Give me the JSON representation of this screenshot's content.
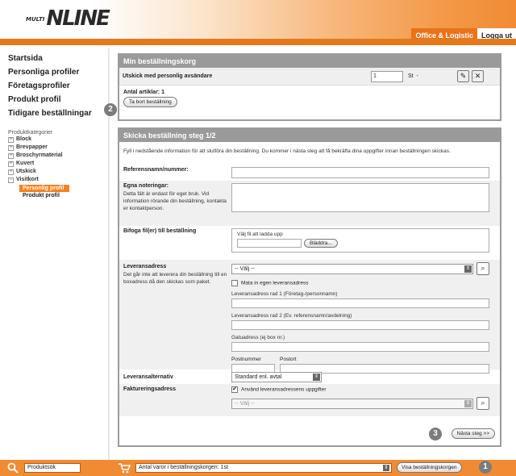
{
  "header": {
    "logo_prefix": "MULTI",
    "logo_text": "NLINE",
    "tab_office": "Office & Logistic",
    "tab_logout": "Logga ut"
  },
  "nav": {
    "main": [
      "Startsida",
      "Personliga profiler",
      "Företagsprofiler",
      "Produkt profil",
      "Tidigare beställningar"
    ],
    "categories_title": "Produktkategorier",
    "categories": [
      "Block",
      "Brevpapper",
      "Broschyrmaterial",
      "Kuvert",
      "Utskick",
      "Visitkort"
    ],
    "sub_active": "Personlig profil",
    "sub_item": "Produkt profil"
  },
  "cart": {
    "title": "Min beställningskorg",
    "item_label": "Utskick med personlig avsändare",
    "qty": "1",
    "unit": "St",
    "unit_dash": "-",
    "antal_label": "Antal artiklar: 1",
    "remove_button": "Ta bort beställning"
  },
  "step": {
    "title": "Skicka beställning steg 1/2",
    "intro": "Fyll i nedstående information för att slutföra din beställning. Du kommer i nästa steg att få bekräfta dina uppgifter innan beställningen skickas.",
    "ref_label": "Referensnamn/nummer:",
    "notes_label": "Egna noteringar:",
    "notes_desc": "Detta fält är endast för eget bruk. Vid information rörande din beställning, kontakta er kontaktperson.",
    "attach_label": "Bifoga fil(er) till beställning",
    "attach_hint": "Välj fil att ladda upp",
    "browse_button": "Bläddra...",
    "delivery_label": "Leveransadress",
    "delivery_desc": "Det går inte att leverera din beställning till en boxadress då den skickas som paket.",
    "delivery_select": "-- Välj --",
    "own_address_label": "Mata in egen leveransadress",
    "addr1_label": "Leveransadress rad 1 (Företag-/personnamn)",
    "addr2_label": "Leveransadress rad 2 (Ev. referensnamn/avdelning)",
    "street_label": "Gatuadress (ej box nr.)",
    "postnr_label": "Postnummer",
    "postort_label": "Postort",
    "alt_label": "Leveransalternativ",
    "alt_select": "Standard enl. avtal",
    "invoice_label": "Faktureringsadress",
    "invoice_check_label": "Använd leveransadressens uppgifter",
    "invoice_select": "-- Välj --",
    "next_button": "Nästa steg >>"
  },
  "badges": {
    "b1": "1",
    "b2": "2",
    "b3": "3"
  },
  "bottom": {
    "search_placeholder": "Produktsök",
    "cart_summary": "Antal varor i beställningskorgen: 1st",
    "show_cart_button": "Visa beställningskorgen"
  }
}
